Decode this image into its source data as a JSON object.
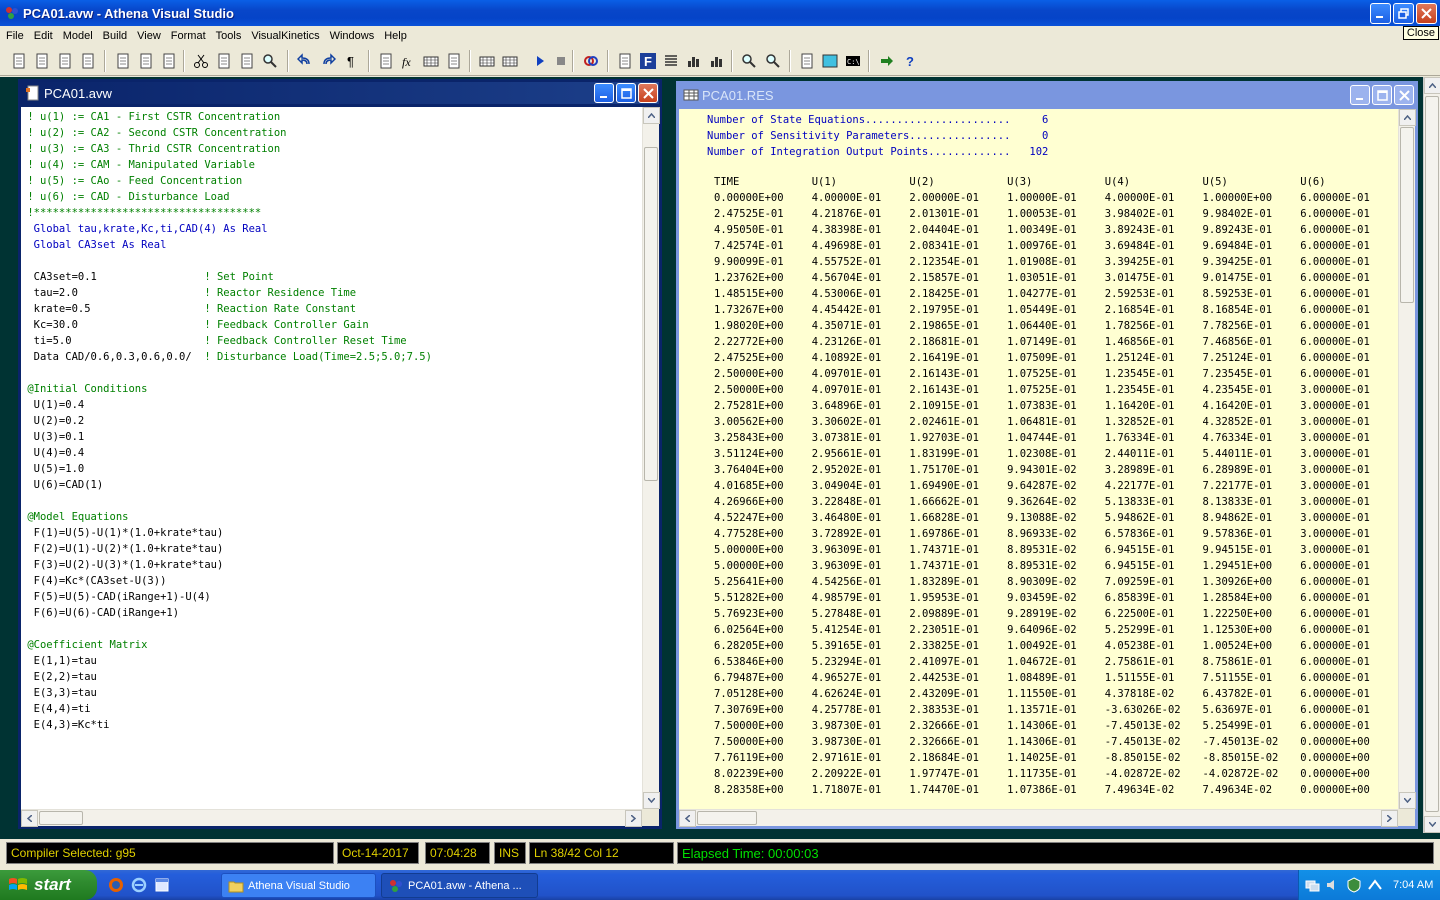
{
  "app": {
    "title": "PCA01.avw - Athena Visual Studio",
    "close_tooltip": "Close"
  },
  "menu": [
    "File",
    "Edit",
    "Model",
    "Build",
    "View",
    "Format",
    "Tools",
    "VisualKinetics",
    "Windows",
    "Help"
  ],
  "toolbar_icons": [
    "new-icon",
    "open-icon",
    "save-icon",
    "save-all-icon",
    "print-icon",
    "print-setup-icon",
    "print-preview-icon",
    "cut-icon",
    "copy-icon",
    "paste-icon",
    "find-icon",
    "undo-icon",
    "redo-icon",
    "paragraph-icon",
    "insert-icon",
    "function-icon",
    "grid-icon",
    "tree-icon",
    "keyboard-icon",
    "calculator-icon",
    "run-icon",
    "stop-icon",
    "link-icon",
    "properties-icon",
    "f-icon",
    "list-icon",
    "plot-icon",
    "bar-chart-icon",
    "zoom-icon",
    "zoom-find-icon",
    "tools-icon",
    "shape-icon",
    "console-icon",
    "arrow-icon",
    "help-icon"
  ],
  "editor": {
    "title": "PCA01.avw",
    "lines": [
      {
        "t": " ! u(1) := CA1 - First CSTR Concentration",
        "c": "green"
      },
      {
        "t": " ! u(2) := CA2 - Second CSTR Concentration",
        "c": "green"
      },
      {
        "t": " ! u(3) := CA3 - Thrid CSTR Concentration",
        "c": "green"
      },
      {
        "t": " ! u(4) := CAM - Manipulated Variable",
        "c": "green"
      },
      {
        "t": " ! u(5) := CAo - Feed Concentration",
        "c": "green"
      },
      {
        "t": " ! u(6) := CAD - Disturbance Load",
        "c": "green"
      },
      {
        "t": " !************************************",
        "c": "green"
      },
      {
        "t": "  Global tau,krate,Kc,ti,CAD(4) As Real",
        "c": "blue"
      },
      {
        "t": "  Global CA3set As Real",
        "c": "blue"
      },
      {
        "t": "",
        "c": "black"
      },
      {
        "t": "  CA3set=0.1                 ! Set Point",
        "c": "mix"
      },
      {
        "t": "  tau=2.0                    ! Reactor Residence Time",
        "c": "mix"
      },
      {
        "t": "  krate=0.5                  ! Reaction Rate Constant",
        "c": "mix"
      },
      {
        "t": "  Kc=30.0                    ! Feedback Controller Gain",
        "c": "mix"
      },
      {
        "t": "  ti=5.0                     ! Feedback Controller Reset Time",
        "c": "mix"
      },
      {
        "t": "  Data CAD/0.6,0.3,0.6,0.0/  ! Disturbance Load(Time=2.5;5.0;7.5)",
        "c": "mix"
      },
      {
        "t": "",
        "c": "black"
      },
      {
        "t": " @Initial Conditions",
        "c": "green"
      },
      {
        "t": "  U(1)=0.4",
        "c": "black"
      },
      {
        "t": "  U(2)=0.2",
        "c": "black"
      },
      {
        "t": "  U(3)=0.1",
        "c": "black"
      },
      {
        "t": "  U(4)=0.4",
        "c": "black"
      },
      {
        "t": "  U(5)=1.0",
        "c": "black"
      },
      {
        "t": "  U(6)=CAD(1)",
        "c": "black"
      },
      {
        "t": "",
        "c": "black"
      },
      {
        "t": " @Model Equations",
        "c": "green"
      },
      {
        "t": "  F(1)=U(5)-U(1)*(1.0+krate*tau)",
        "c": "black"
      },
      {
        "t": "  F(2)=U(1)-U(2)*(1.0+krate*tau)",
        "c": "black"
      },
      {
        "t": "  F(3)=U(2)-U(3)*(1.0+krate*tau)",
        "c": "black"
      },
      {
        "t": "  F(4)=Kc*(CA3set-U(3))",
        "c": "black"
      },
      {
        "t": "  F(5)=U(5)-CAD(iRange+1)-U(4)",
        "c": "black"
      },
      {
        "t": "  F(6)=U(6)-CAD(iRange+1)",
        "c": "black"
      },
      {
        "t": "",
        "c": "black"
      },
      {
        "t": " @Coefficient Matrix",
        "c": "green"
      },
      {
        "t": "  E(1,1)=tau",
        "c": "black"
      },
      {
        "t": "  E(2,2)=tau",
        "c": "black"
      },
      {
        "t": "  E(3,3)=tau",
        "c": "black"
      },
      {
        "t": "  E(4,4)=ti",
        "c": "black"
      },
      {
        "t": "  E(4,3)=Kc*ti",
        "c": "black"
      }
    ]
  },
  "results": {
    "title": "PCA01.RES",
    "header_lines": [
      "Number of State Equations.......................     6",
      "Number of Sensitivity Parameters................     0",
      "Number of Integration Output Points.............   102"
    ],
    "columns": [
      "TIME",
      "U(1)",
      "U(2)",
      "U(3)",
      "U(4)",
      "U(5)",
      "U(6)"
    ],
    "rows": [
      [
        "0.00000E+00",
        "4.00000E-01",
        "2.00000E-01",
        "1.00000E-01",
        "4.00000E-01",
        "1.00000E+00",
        "6.00000E-01"
      ],
      [
        "2.47525E-01",
        "4.21876E-01",
        "2.01301E-01",
        "1.00053E-01",
        "3.98402E-01",
        "9.98402E-01",
        "6.00000E-01"
      ],
      [
        "4.95050E-01",
        "4.38398E-01",
        "2.04404E-01",
        "1.00349E-01",
        "3.89243E-01",
        "9.89243E-01",
        "6.00000E-01"
      ],
      [
        "7.42574E-01",
        "4.49698E-01",
        "2.08341E-01",
        "1.00976E-01",
        "3.69484E-01",
        "9.69484E-01",
        "6.00000E-01"
      ],
      [
        "9.90099E-01",
        "4.55752E-01",
        "2.12354E-01",
        "1.01908E-01",
        "3.39425E-01",
        "9.39425E-01",
        "6.00000E-01"
      ],
      [
        "1.23762E+00",
        "4.56704E-01",
        "2.15857E-01",
        "1.03051E-01",
        "3.01475E-01",
        "9.01475E-01",
        "6.00000E-01"
      ],
      [
        "1.48515E+00",
        "4.53006E-01",
        "2.18425E-01",
        "1.04277E-01",
        "2.59253E-01",
        "8.59253E-01",
        "6.00000E-01"
      ],
      [
        "1.73267E+00",
        "4.45442E-01",
        "2.19795E-01",
        "1.05449E-01",
        "2.16854E-01",
        "8.16854E-01",
        "6.00000E-01"
      ],
      [
        "1.98020E+00",
        "4.35071E-01",
        "2.19865E-01",
        "1.06440E-01",
        "1.78256E-01",
        "7.78256E-01",
        "6.00000E-01"
      ],
      [
        "2.22772E+00",
        "4.23126E-01",
        "2.18681E-01",
        "1.07149E-01",
        "1.46856E-01",
        "7.46856E-01",
        "6.00000E-01"
      ],
      [
        "2.47525E+00",
        "4.10892E-01",
        "2.16419E-01",
        "1.07509E-01",
        "1.25124E-01",
        "7.25124E-01",
        "6.00000E-01"
      ],
      [
        "2.50000E+00",
        "4.09701E-01",
        "2.16143E-01",
        "1.07525E-01",
        "1.23545E-01",
        "7.23545E-01",
        "6.00000E-01"
      ],
      [
        "2.50000E+00",
        "4.09701E-01",
        "2.16143E-01",
        "1.07525E-01",
        "1.23545E-01",
        "4.23545E-01",
        "3.00000E-01"
      ],
      [
        "2.75281E+00",
        "3.64896E-01",
        "2.10915E-01",
        "1.07383E-01",
        "1.16420E-01",
        "4.16420E-01",
        "3.00000E-01"
      ],
      [
        "3.00562E+00",
        "3.30602E-01",
        "2.02461E-01",
        "1.06481E-01",
        "1.32852E-01",
        "4.32852E-01",
        "3.00000E-01"
      ],
      [
        "3.25843E+00",
        "3.07381E-01",
        "1.92703E-01",
        "1.04744E-01",
        "1.76334E-01",
        "4.76334E-01",
        "3.00000E-01"
      ],
      [
        "3.51124E+00",
        "2.95661E-01",
        "1.83199E-01",
        "1.02308E-01",
        "2.44011E-01",
        "5.44011E-01",
        "3.00000E-01"
      ],
      [
        "3.76404E+00",
        "2.95202E-01",
        "1.75170E-01",
        "9.94301E-02",
        "3.28989E-01",
        "6.28989E-01",
        "3.00000E-01"
      ],
      [
        "4.01685E+00",
        "3.04904E-01",
        "1.69490E-01",
        "9.64287E-02",
        "4.22177E-01",
        "7.22177E-01",
        "3.00000E-01"
      ],
      [
        "4.26966E+00",
        "3.22848E-01",
        "1.66662E-01",
        "9.36264E-02",
        "5.13833E-01",
        "8.13833E-01",
        "3.00000E-01"
      ],
      [
        "4.52247E+00",
        "3.46480E-01",
        "1.66828E-01",
        "9.13088E-02",
        "5.94862E-01",
        "8.94862E-01",
        "3.00000E-01"
      ],
      [
        "4.77528E+00",
        "3.72892E-01",
        "1.69786E-01",
        "8.96933E-02",
        "6.57836E-01",
        "9.57836E-01",
        "3.00000E-01"
      ],
      [
        "5.00000E+00",
        "3.96309E-01",
        "1.74371E-01",
        "8.89531E-02",
        "6.94515E-01",
        "9.94515E-01",
        "3.00000E-01"
      ],
      [
        "5.00000E+00",
        "3.96309E-01",
        "1.74371E-01",
        "8.89531E-02",
        "6.94515E-01",
        "1.29451E+00",
        "6.00000E-01"
      ],
      [
        "5.25641E+00",
        "4.54256E-01",
        "1.83289E-01",
        "8.90309E-02",
        "7.09259E-01",
        "1.30926E+00",
        "6.00000E-01"
      ],
      [
        "5.51282E+00",
        "4.98579E-01",
        "1.95953E-01",
        "9.03459E-02",
        "6.85839E-01",
        "1.28584E+00",
        "6.00000E-01"
      ],
      [
        "5.76923E+00",
        "5.27848E-01",
        "2.09889E-01",
        "9.28919E-02",
        "6.22500E-01",
        "1.22250E+00",
        "6.00000E-01"
      ],
      [
        "6.02564E+00",
        "5.41254E-01",
        "2.23051E-01",
        "9.64096E-02",
        "5.25299E-01",
        "1.12530E+00",
        "6.00000E-01"
      ],
      [
        "6.28205E+00",
        "5.39165E-01",
        "2.33825E-01",
        "1.00492E-01",
        "4.05238E-01",
        "1.00524E+00",
        "6.00000E-01"
      ],
      [
        "6.53846E+00",
        "5.23294E-01",
        "2.41097E-01",
        "1.04672E-01",
        "2.75861E-01",
        "8.75861E-01",
        "6.00000E-01"
      ],
      [
        "6.79487E+00",
        "4.96527E-01",
        "2.44253E-01",
        "1.08489E-01",
        "1.51155E-01",
        "7.51155E-01",
        "6.00000E-01"
      ],
      [
        "7.05128E+00",
        "4.62624E-01",
        "2.43209E-01",
        "1.11550E-01",
        "4.37818E-02",
        "6.43782E-01",
        "6.00000E-01"
      ],
      [
        "7.30769E+00",
        "4.25778E-01",
        "2.38353E-01",
        "1.13571E-01",
        "-3.63026E-02",
        "5.63697E-01",
        "6.00000E-01"
      ],
      [
        "7.50000E+00",
        "3.98730E-01",
        "2.32666E-01",
        "1.14306E-01",
        "-7.45013E-02",
        "5.25499E-01",
        "6.00000E-01"
      ],
      [
        "7.50000E+00",
        "3.98730E-01",
        "2.32666E-01",
        "1.14306E-01",
        "-7.45013E-02",
        "-7.45013E-02",
        "0.00000E+00"
      ],
      [
        "7.76119E+00",
        "2.97161E-01",
        "2.18684E-01",
        "1.14025E-01",
        "-8.85015E-02",
        "-8.85015E-02",
        "0.00000E+00"
      ],
      [
        "8.02239E+00",
        "2.20922E-01",
        "1.97747E-01",
        "1.11735E-01",
        "-4.02872E-02",
        "-4.02872E-02",
        "0.00000E+00"
      ],
      [
        "8.28358E+00",
        "1.71807E-01",
        "1.74470E-01",
        "1.07386E-01",
        "7.49634E-02",
        "7.49634E-02",
        "0.00000E+00"
      ]
    ]
  },
  "status": {
    "compiler": "Compiler Selected:  g95",
    "date": "Oct-14-2017",
    "time": "07:04:28",
    "mode": "INS",
    "position": "Ln 38/42  Col 12",
    "elapsed": "Elapsed Time: 00:00:03"
  },
  "taskbar": {
    "start": "start",
    "tasks": [
      "Athena Visual Studio",
      "PCA01.avw - Athena ..."
    ],
    "clock": "7:04 AM"
  }
}
